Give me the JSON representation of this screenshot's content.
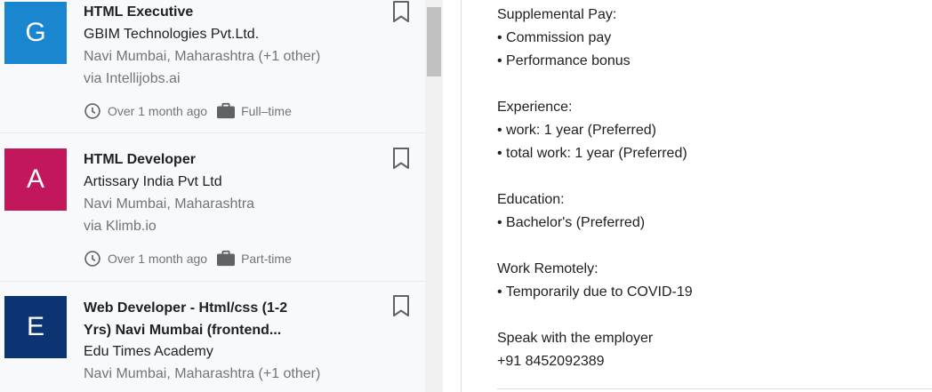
{
  "jobs": [
    {
      "logo_letter": "G",
      "logo_color": "#1a86d0",
      "title": "HTML Executive",
      "company": "GBIM Technologies Pvt.Ltd.",
      "location": "Navi Mumbai, Maharashtra (+1 other)",
      "via": "via Intellijobs.ai",
      "posted": "Over 1 month ago",
      "type": "Full–time"
    },
    {
      "logo_letter": "A",
      "logo_color": "#c2185b",
      "title": "HTML Developer",
      "company": "Artissary India Pvt Ltd",
      "location": "Navi Mumbai, Maharashtra",
      "via": "via Klimb.io",
      "posted": "Over 1 month ago",
      "type": "Part-time"
    },
    {
      "logo_letter": "E",
      "logo_color": "#0d3472",
      "title_line1": "Web Developer - Html/css (1-2",
      "title_line2": "Yrs) Navi Mumbai (frontend...",
      "company": "Edu Times Academy",
      "location": "Navi Mumbai, Maharashtra (+1 other)"
    }
  ],
  "detail": {
    "supplemental_heading": "Supplemental Pay:",
    "supplemental_items": [
      "• Commission pay",
      "• Performance bonus"
    ],
    "experience_heading": "Experience:",
    "experience_items": [
      "• work: 1 year (Preferred)",
      "• total work: 1 year (Preferred)"
    ],
    "education_heading": "Education:",
    "education_items": [
      "• Bachelor's (Preferred)"
    ],
    "remote_heading": "Work Remotely:",
    "remote_items": [
      "• Temporarily due to COVID-19"
    ],
    "contact_heading": "Speak with the employer",
    "contact_phone": "+91 8452092389"
  },
  "icons": {
    "bookmark": "bookmark-icon",
    "clock": "clock-icon",
    "briefcase": "briefcase-icon"
  }
}
